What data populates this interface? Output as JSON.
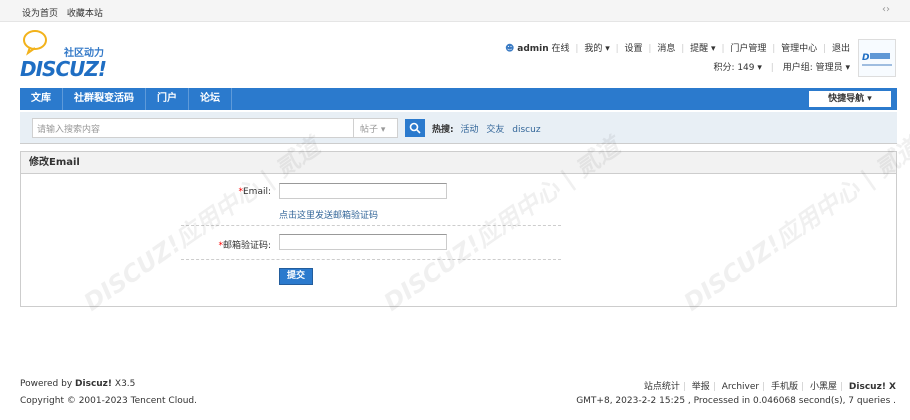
{
  "topbar": {
    "set_home": "设为首页",
    "favorite": "收藏本站",
    "toggle_icon": "‹›"
  },
  "logo": {
    "slogan": "社区动力",
    "word": "DISCUZ!"
  },
  "user_menu": {
    "username": "admin",
    "status": "在线",
    "my": "我的",
    "settings": "设置",
    "messages": "消息",
    "remind": "提醒",
    "portal_manage": "门户管理",
    "admin_center": "管理中心",
    "logout": "退出",
    "points": "积分: 149",
    "group": "用户组: 管理员"
  },
  "nav": {
    "items": [
      {
        "label": "文库"
      },
      {
        "label": "社群裂变活码"
      },
      {
        "label": "门户"
      },
      {
        "label": "论坛"
      }
    ],
    "quick_nav": "快捷导航"
  },
  "search": {
    "placeholder": "请输入搜索内容",
    "scope": "帖子",
    "hot_label": "热搜:",
    "hot_tags": [
      "活动",
      "交友",
      "discuz"
    ]
  },
  "form": {
    "title": "修改Email",
    "email_label": "Email:",
    "email_value": "",
    "send_link": "点击这里发送邮箱验证码",
    "code_label": "邮箱验证码:",
    "code_value": "",
    "submit": "提交"
  },
  "footer": {
    "powered_prefix": "Powered by ",
    "powered_brand": "Discuz!",
    "version": "X3.5",
    "copyright": "Copyright © 2001-2023 Tencent Cloud.",
    "links": [
      "站点统计",
      "举报",
      "Archiver",
      "手机版",
      "小黑屋"
    ],
    "brand": "Discuz! X",
    "gmt": "GMT+8, 2023-2-2 15:25 , Processed in 0.046068 second(s), 7 queries ."
  },
  "watermark": {
    "text": "DISCUZ!应用中心 | 贰道"
  },
  "colors": {
    "accent": "#2b7acd",
    "link": "#336699",
    "required": "#ff0000"
  }
}
